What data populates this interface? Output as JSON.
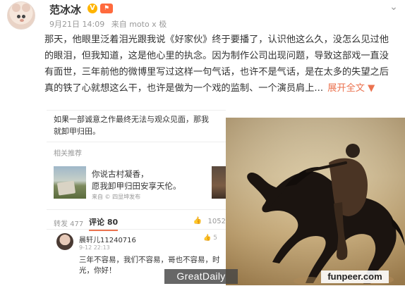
{
  "header": {
    "username": "范冰冰",
    "v_badge": "V",
    "rank_badge": "⚑",
    "timestamp": "9月21日 14:09",
    "source": "来自 moto x 极",
    "chevron_icon": "chevron-down-icon"
  },
  "post": {
    "text": "那天，他眼里泛着泪光跟我说《好家伙》终于要播了，认识他这么久，没怎么见过他的眼泪，但我知道，这是他心里的执念。因为制作公司出现问题，导致这部戏一直没有面世，三年前他的微博里写过这样一句气话，也许不是气话，是在太多的失望之后真的铁了心就想这么干，也许是做为一个戏的监制、一个演员肩上...",
    "expand_label": "展开全文",
    "expand_icon": "▼"
  },
  "embedded": {
    "quote_text_line1": "如果一部诚意之作最终无法与观众见面，那我",
    "quote_text_line2": "就卸甲归田。",
    "related_title": "相关推荐",
    "related_text_line1": "你说古村凝香，",
    "related_text_line2": "愿我卸甲归田安享天伦。",
    "related_author": "来自 © 四显坤发布",
    "share_label": "转发 477",
    "comments_label": "评论 80",
    "likes_label": "1052",
    "comment": {
      "user": "晨轩儿11240716",
      "time": "9-12 22:13",
      "likes": "5",
      "text": "三年不容易，我们不容易，哥也不容易，时光，你好！"
    }
  },
  "watermarks": {
    "left": "GreatDaily",
    "right": "funpeer.com"
  }
}
